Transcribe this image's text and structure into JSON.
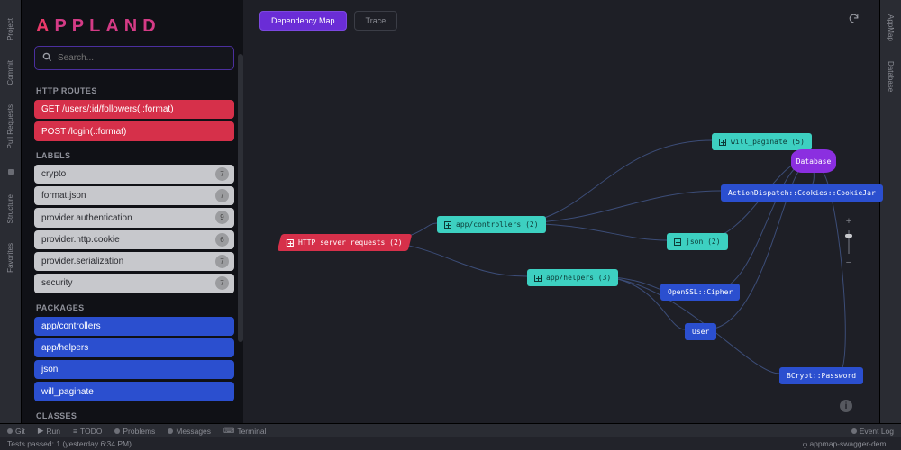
{
  "brand": {
    "full": "APPLAND"
  },
  "search": {
    "placeholder": "Search..."
  },
  "sidebar": {
    "sections": {
      "routes": {
        "header": "HTTP ROUTES",
        "items": [
          {
            "label": "GET /users/:id/followers(.:format)"
          },
          {
            "label": "POST /login(.:format)"
          }
        ]
      },
      "labels": {
        "header": "LABELS",
        "items": [
          {
            "label": "crypto",
            "count": "7"
          },
          {
            "label": "format.json",
            "count": "7"
          },
          {
            "label": "provider.authentication",
            "count": "9"
          },
          {
            "label": "provider.http.cookie",
            "count": "6"
          },
          {
            "label": "provider.serialization",
            "count": "7"
          },
          {
            "label": "security",
            "count": "7"
          }
        ]
      },
      "packages": {
        "header": "PACKAGES",
        "items": [
          {
            "label": "app/controllers"
          },
          {
            "label": "app/helpers"
          },
          {
            "label": "json"
          },
          {
            "label": "will_paginate"
          }
        ]
      },
      "classes": {
        "header": "CLASSES",
        "items": [
          {
            "label": "ActionDispatch::Cookies::CookieJar"
          }
        ]
      }
    }
  },
  "tabs": {
    "dependency": "Dependency Map",
    "trace": "Trace"
  },
  "nodes": {
    "root": "HTTP server requests (2)",
    "controllers": "app/controllers (2)",
    "helpers": "app/helpers (3)",
    "paginate": "will_paginate (5)",
    "cookiejar": "ActionDispatch::Cookies::CookieJar",
    "json": "json (2)",
    "cipher": "OpenSSL::Cipher",
    "user": "User",
    "bcrypt": "BCrypt::Password",
    "database": "Database"
  },
  "zoom": {
    "plus": "+",
    "minus": "−"
  },
  "bottom": {
    "git": "Git",
    "run": "Run",
    "todo": "TODO",
    "problems": "Problems",
    "messages": "Messages",
    "terminal": "Terminal",
    "eventlog": "Event Log",
    "tests": "Tests passed: 1 (yesterday 6:34 PM)",
    "branch": "appmap-swagger-dem…"
  },
  "rails": {
    "left": [
      "Project",
      "Commit",
      "Pull Requests",
      "Structure",
      "Favorites"
    ],
    "right": [
      "AppMap",
      "Database"
    ]
  }
}
